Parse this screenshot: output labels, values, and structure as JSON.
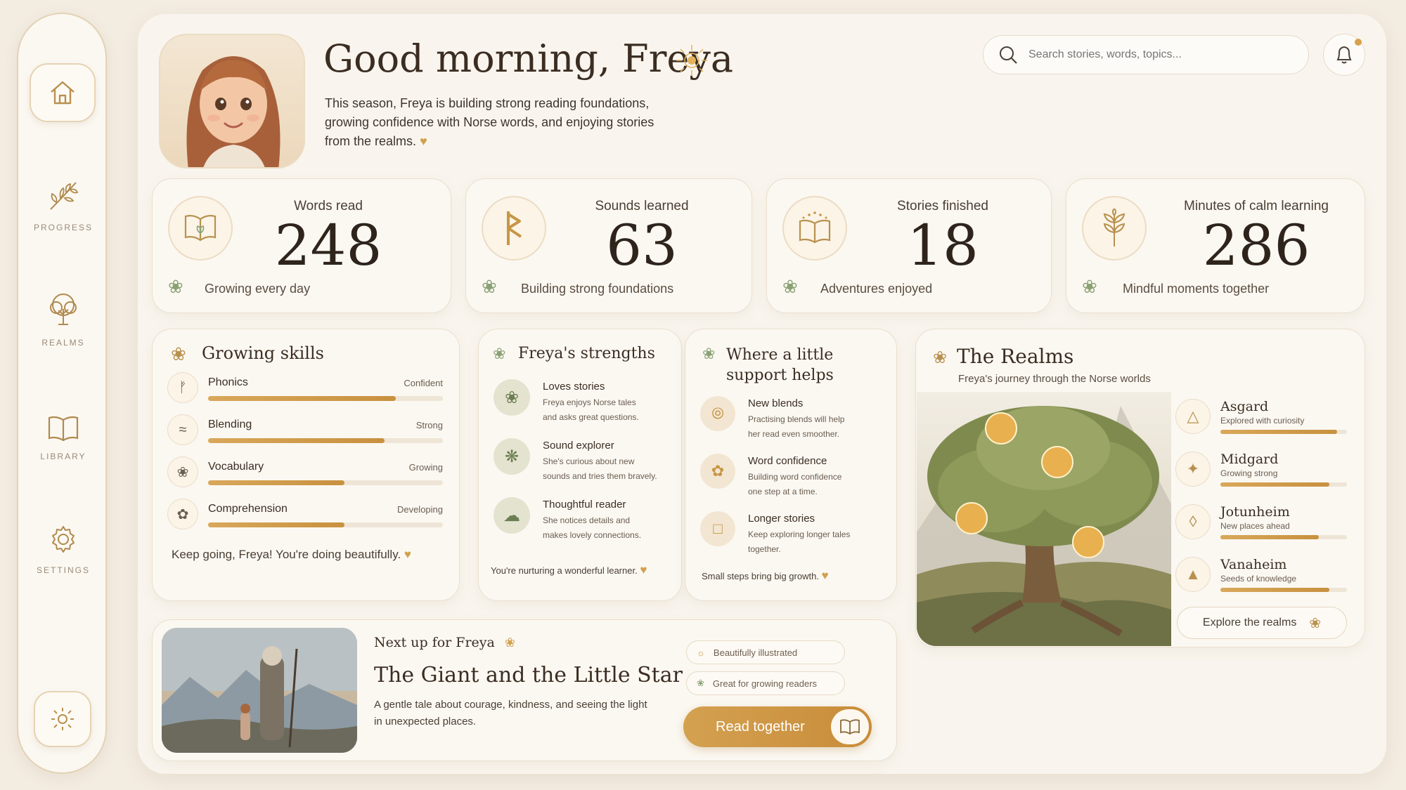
{
  "sidebar": {
    "items": [
      {
        "label": "",
        "icon": "home-icon"
      },
      {
        "label": "PROGRESS",
        "icon": "sprig-icon"
      },
      {
        "label": "REALMS",
        "icon": "tree-icon"
      },
      {
        "label": "LIBRARY",
        "icon": "book-icon"
      },
      {
        "label": "SETTINGS",
        "icon": "gear-icon"
      }
    ],
    "theme_icon": "sun-icon"
  },
  "header": {
    "greeting": "Good morning, Freya",
    "intro": "This season, Freya is building strong reading foundations, growing confidence with Norse words, and enjoying stories from the realms.",
    "search_placeholder": "Search stories, words, topics...",
    "notification_icon": "bell-icon"
  },
  "stats": [
    {
      "label": "Words read",
      "value": "248",
      "caption": "Growing every day",
      "icon": "open-book-icon"
    },
    {
      "label": "Sounds learned",
      "value": "63",
      "caption": "Building strong foundations",
      "icon": "rune-icon"
    },
    {
      "label": "Stories finished",
      "value": "18",
      "caption": "Adventures enjoyed",
      "icon": "sparkle-book-icon"
    },
    {
      "label": "Minutes of calm learning",
      "value": "286",
      "caption": "Mindful moments together",
      "icon": "leaf-icon"
    }
  ],
  "skills": {
    "title": "Growing skills",
    "items": [
      {
        "name": "Phonics",
        "level": "Confident",
        "progress": 0.8
      },
      {
        "name": "Blending",
        "level": "Strong",
        "progress": 0.75
      },
      {
        "name": "Vocabulary",
        "level": "Growing",
        "progress": 0.58
      },
      {
        "name": "Comprehension",
        "level": "Developing",
        "progress": 0.58
      }
    ],
    "footer": "Keep going, Freya! You're doing beautifully."
  },
  "strengths": {
    "title": "Freya's strengths",
    "items": [
      {
        "title": "Loves stories",
        "desc1": "Freya enjoys Norse tales",
        "desc2": "and asks great questions."
      },
      {
        "title": "Sound explorer",
        "desc1": "She's curious about new",
        "desc2": "sounds and tries them bravely."
      },
      {
        "title": "Thoughtful reader",
        "desc1": "She notices details and",
        "desc2": "makes lovely connections."
      }
    ],
    "footer": "You're nurturing a wonderful learner."
  },
  "support": {
    "title1": "Where a little",
    "title2": "support helps",
    "items": [
      {
        "title": "New blends",
        "desc1": "Practising blends will help",
        "desc2": "her read even smoother."
      },
      {
        "title": "Word confidence",
        "desc1": "Building word confidence",
        "desc2": "one step at a time."
      },
      {
        "title": "Longer stories",
        "desc1": "Keep exploring longer tales",
        "desc2": "together."
      }
    ],
    "footer": "Small steps bring big growth."
  },
  "realms": {
    "title": "The Realms",
    "subtitle": "Freya's journey through the Norse worlds",
    "items": [
      {
        "name": "Asgard",
        "desc": "Explored with curiosity",
        "progress": 0.92
      },
      {
        "name": "Midgard",
        "desc": "Growing strong",
        "progress": 0.86
      },
      {
        "name": "Jotunheim",
        "desc": "New places ahead",
        "progress": 0.78
      },
      {
        "name": "Vanaheim",
        "desc": "Seeds of knowledge",
        "progress": 0.86
      }
    ],
    "button": "Explore the realms"
  },
  "next": {
    "label": "Next up for Freya",
    "title": "The Giant and the Little Star",
    "desc": "A gentle tale about courage, kindness, and seeing the light in unexpected places.",
    "tags": [
      "Beautifully illustrated",
      "Great for growing readers"
    ],
    "button": "Read together"
  }
}
